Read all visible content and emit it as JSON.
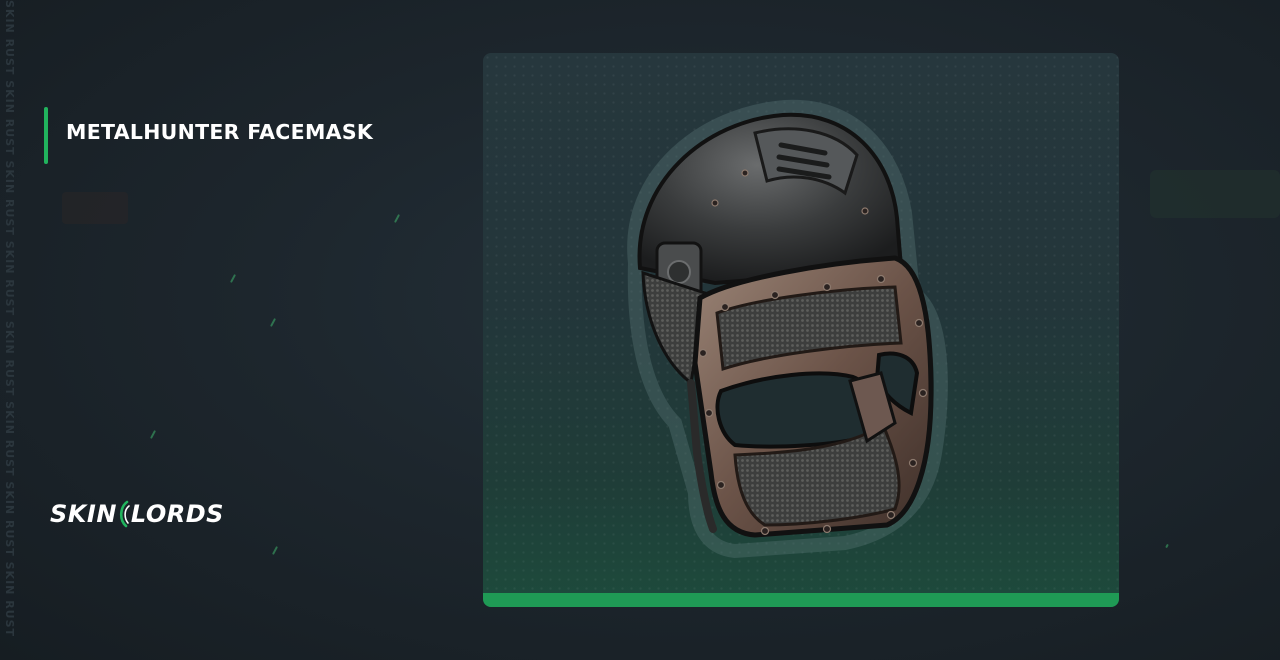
{
  "item": {
    "name": "METALHUNTER FACEMASK"
  },
  "branding": {
    "logo_left": "SKIN",
    "logo_right": "LORDS",
    "watermark": "SKIN RUST SKIN RUST SKIN RUST SKIN RUST SKIN RUST SKIN RUST SKIN RUST SKIN RUST"
  },
  "colors": {
    "accent": "#21b35d",
    "background": "#1d262d",
    "card_top": "#26373d",
    "card_bottom": "#1d4b3c"
  },
  "icons": {
    "item_image": "metalhunter-facemask-image",
    "logo_mark": "skinlords-logo-mark-icon"
  }
}
